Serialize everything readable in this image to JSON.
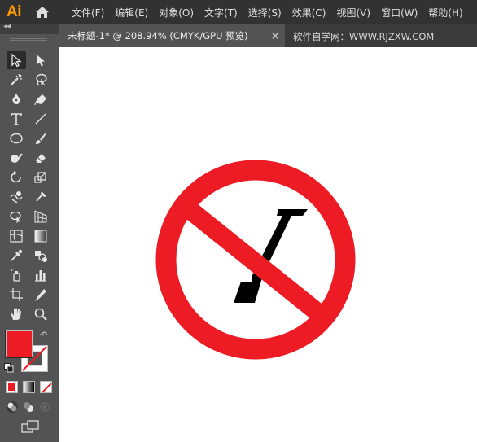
{
  "app": {
    "logo": "Ai",
    "home_icon": "home-icon"
  },
  "menu": [
    "文件(F)",
    "编辑(E)",
    "对象(O)",
    "文字(T)",
    "选择(S)",
    "效果(C)",
    "视图(V)",
    "窗口(W)",
    "帮助(H)"
  ],
  "tab": {
    "title": "未标题-1* @ 208.94% (CMYK/GPU 预览)",
    "close": "×"
  },
  "watermark": "软件自学网：WWW.RJZXW.COM",
  "toolbar": {
    "collapse": "◂◂",
    "swap": "↶",
    "fill_color": "#ed1c24",
    "stroke_color": "none"
  },
  "artwork": {
    "ring_color": "#ed1c24",
    "symbol_color": "#000000",
    "type": "prohibition-sign"
  }
}
